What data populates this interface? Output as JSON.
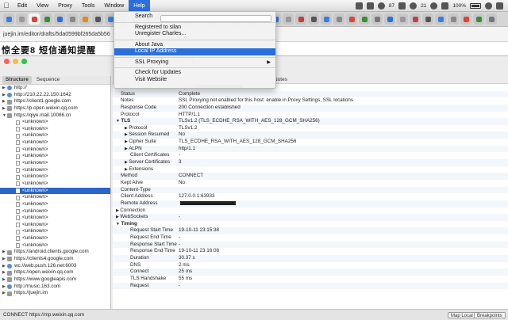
{
  "menubar": {
    "items": [
      "Edit",
      "View",
      "Proxy",
      "Tools",
      "Window",
      "Help"
    ],
    "status": {
      "battery_pct": "100%",
      "badge_count": "87",
      "other_count": "21"
    }
  },
  "browser": {
    "url": "juejin.im/editor/drafts/5da0599bf265da5b56",
    "page_heading": "惊全要8 短信通知提醒"
  },
  "help_menu": {
    "search": "Search",
    "items": [
      "Registered to silan",
      "Unregister Charles...",
      "About Java",
      "Local IP Address",
      "SSL Proxying",
      "Check for Updates",
      "Visit Website"
    ]
  },
  "charles": {
    "left_tabs": [
      "Structure",
      "Sequence"
    ],
    "tree": [
      {
        "label": "http://",
        "kind": "host",
        "expanded": false,
        "icon": "globe"
      },
      {
        "label": "http://210.22.22.150:1642",
        "kind": "host",
        "expanded": false,
        "icon": "globe"
      },
      {
        "label": "https://client1.google.com",
        "kind": "host",
        "expanded": false,
        "icon": "lock"
      },
      {
        "label": "https://p.open.weixin.qq.com",
        "kind": "host",
        "expanded": false,
        "icon": "lock"
      },
      {
        "label": "https://qiye.mail.10086.cn",
        "kind": "host",
        "expanded": true,
        "icon": "lock"
      },
      {
        "label": "<unknown>",
        "kind": "child"
      },
      {
        "label": "<unknown>",
        "kind": "child"
      },
      {
        "label": "<unknown>",
        "kind": "child"
      },
      {
        "label": "<unknown>",
        "kind": "child"
      },
      {
        "label": "<unknown>",
        "kind": "child"
      },
      {
        "label": "<unknown>",
        "kind": "child"
      },
      {
        "label": "<unknown>",
        "kind": "child"
      },
      {
        "label": "<unknown>",
        "kind": "child"
      },
      {
        "label": "<unknown>",
        "kind": "child"
      },
      {
        "label": "<unknown>",
        "kind": "child"
      },
      {
        "label": "<unknown>",
        "kind": "child",
        "selected": true
      },
      {
        "label": "<unknown>",
        "kind": "child"
      },
      {
        "label": "<unknown>",
        "kind": "child"
      },
      {
        "label": "<unknown>",
        "kind": "child"
      },
      {
        "label": "<unknown>",
        "kind": "child"
      },
      {
        "label": "<unknown>",
        "kind": "child"
      },
      {
        "label": "<unknown>",
        "kind": "child"
      },
      {
        "label": "<unknown>",
        "kind": "child"
      },
      {
        "label": "<unknown>",
        "kind": "child"
      },
      {
        "label": "https://android.clients.google.com",
        "kind": "host",
        "expanded": false,
        "icon": "lock"
      },
      {
        "label": "https://clients4.google.com",
        "kind": "host",
        "expanded": false,
        "icon": "lock"
      },
      {
        "label": "wc://web.push.126.net:6003",
        "kind": "host",
        "expanded": false,
        "icon": "globe"
      },
      {
        "label": "https://open.weixin.qq.com",
        "kind": "host",
        "expanded": false,
        "icon": "lock"
      },
      {
        "label": "https://www.googleapis.com",
        "kind": "host",
        "expanded": false,
        "icon": "lock"
      },
      {
        "label": "http://music.163.com",
        "kind": "host",
        "expanded": false,
        "icon": "globe"
      },
      {
        "label": "https://juejin.im",
        "kind": "host",
        "expanded": false,
        "icon": "lock"
      }
    ],
    "right_tab": "Notes",
    "details": [
      {
        "name": "URL",
        "value": "https://",
        "lvl": 1,
        "redact": 60
      },
      {
        "name": "Status",
        "value": "Complete",
        "lvl": 1
      },
      {
        "name": "Notes",
        "value": "SSL Proxying not enabled for this host: enable in Proxy Settings, SSL locations",
        "lvl": 1
      },
      {
        "name": "Response Code",
        "value": "200 Connection established",
        "lvl": 1
      },
      {
        "name": "Protocol",
        "value": "HTTP/1.1",
        "lvl": 1
      },
      {
        "name": "TLS",
        "value": "TLSv1.2 (TLS_ECDHE_RSA_WITH_AES_128_GCM_SHA256)",
        "lvl": 0,
        "tw": "▼"
      },
      {
        "name": "Protocol",
        "value": "TLSv1.2",
        "lvl": 2,
        "tw": "▶"
      },
      {
        "name": "Session Resumed",
        "value": "No",
        "lvl": 2,
        "tw": "▶"
      },
      {
        "name": "Cipher Suite",
        "value": "TLS_ECDHE_RSA_WITH_AES_128_GCM_SHA256",
        "lvl": 2,
        "tw": "▶"
      },
      {
        "name": "ALPN",
        "value": "http/1.1",
        "lvl": 2,
        "tw": "▶"
      },
      {
        "name": "Client Certificates",
        "value": "-",
        "lvl": 3
      },
      {
        "name": "Server Certificates",
        "value": "3",
        "lvl": 2,
        "tw": "▶"
      },
      {
        "name": "Extensions",
        "value": "",
        "lvl": 2,
        "tw": "▶"
      },
      {
        "name": "Method",
        "value": "CONNECT",
        "lvl": 1
      },
      {
        "name": "Kept Alive",
        "value": "No",
        "lvl": 1
      },
      {
        "name": "Content-Type",
        "value": "",
        "lvl": 1
      },
      {
        "name": "Client Address",
        "value": "127.0.0.1:63933",
        "lvl": 1
      },
      {
        "name": "Remote Address",
        "value": "",
        "lvl": 1,
        "redact": 70
      },
      {
        "name": "Connection",
        "value": "",
        "lvl": 0,
        "tw": "▶",
        "plain": true
      },
      {
        "name": "WebSockets",
        "value": "-",
        "lvl": 0,
        "tw": "▶",
        "plain": true
      },
      {
        "name": "Timing",
        "value": "",
        "lvl": 0,
        "tw": "▼"
      },
      {
        "name": "Request Start Time",
        "value": "19-10-11 23:15:38",
        "lvl": 3
      },
      {
        "name": "Request End Time",
        "value": "-",
        "lvl": 3
      },
      {
        "name": "Response Start Time",
        "value": "-",
        "lvl": 3
      },
      {
        "name": "Response End Time",
        "value": "19-10-11 23:16:08",
        "lvl": 3
      },
      {
        "name": "Duration",
        "value": "30.37 s",
        "lvl": 3
      },
      {
        "name": "DNS",
        "value": "2 ms",
        "lvl": 3
      },
      {
        "name": "Connect",
        "value": "25 ms",
        "lvl": 3
      },
      {
        "name": "TLS Handshake",
        "value": "55 ms",
        "lvl": 3
      },
      {
        "name": "Request",
        "value": "-",
        "lvl": 3
      }
    ],
    "status_text": "CONNECT https://mp.weixin.qq.com",
    "map_local": "Map Local",
    "breakpoints": "Breakpoints"
  },
  "colors": {
    "accent": "#2b6fdc",
    "selection": "#2c64c8"
  }
}
